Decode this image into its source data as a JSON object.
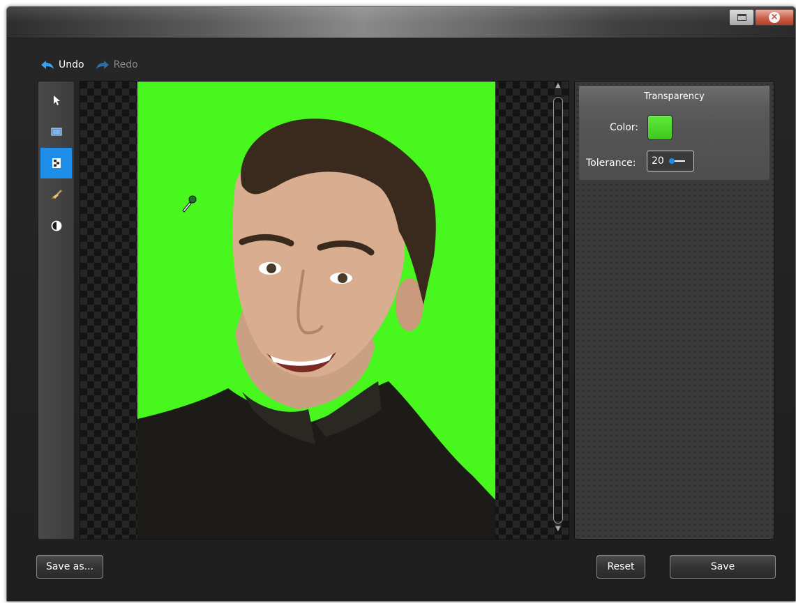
{
  "toolbar": {
    "undo_label": "Undo",
    "redo_label": "Redo"
  },
  "tools": [
    {
      "icon": "pointer-icon",
      "active": false
    },
    {
      "icon": "crop-icon",
      "active": false
    },
    {
      "icon": "transparency-icon",
      "active": true
    },
    {
      "icon": "brush-icon",
      "active": false
    },
    {
      "icon": "contrast-icon",
      "active": false
    }
  ],
  "canvas": {
    "background_color": "#47f71e",
    "cursor": "eyedropper-icon"
  },
  "panel": {
    "title": "Transparency",
    "color_label": "Color:",
    "color_value": "#4fd82e",
    "tolerance_label": "Tolerance:",
    "tolerance_value": "20"
  },
  "buttons": {
    "save_as": "Save as...",
    "reset": "Reset",
    "save": "Save"
  },
  "accent_color": "#1e8ee8"
}
